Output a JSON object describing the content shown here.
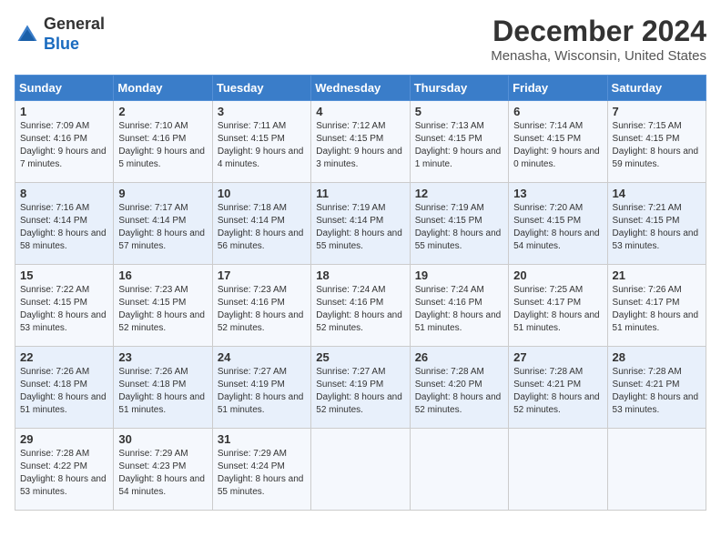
{
  "logo": {
    "general": "General",
    "blue": "Blue"
  },
  "title": "December 2024",
  "location": "Menasha, Wisconsin, United States",
  "days_of_week": [
    "Sunday",
    "Monday",
    "Tuesday",
    "Wednesday",
    "Thursday",
    "Friday",
    "Saturday"
  ],
  "weeks": [
    [
      {
        "day": "1",
        "sunrise": "7:09 AM",
        "sunset": "4:16 PM",
        "daylight": "9 hours and 7 minutes."
      },
      {
        "day": "2",
        "sunrise": "7:10 AM",
        "sunset": "4:16 PM",
        "daylight": "9 hours and 5 minutes."
      },
      {
        "day": "3",
        "sunrise": "7:11 AM",
        "sunset": "4:15 PM",
        "daylight": "9 hours and 4 minutes."
      },
      {
        "day": "4",
        "sunrise": "7:12 AM",
        "sunset": "4:15 PM",
        "daylight": "9 hours and 3 minutes."
      },
      {
        "day": "5",
        "sunrise": "7:13 AM",
        "sunset": "4:15 PM",
        "daylight": "9 hours and 1 minute."
      },
      {
        "day": "6",
        "sunrise": "7:14 AM",
        "sunset": "4:15 PM",
        "daylight": "9 hours and 0 minutes."
      },
      {
        "day": "7",
        "sunrise": "7:15 AM",
        "sunset": "4:15 PM",
        "daylight": "8 hours and 59 minutes."
      }
    ],
    [
      {
        "day": "8",
        "sunrise": "7:16 AM",
        "sunset": "4:14 PM",
        "daylight": "8 hours and 58 minutes."
      },
      {
        "day": "9",
        "sunrise": "7:17 AM",
        "sunset": "4:14 PM",
        "daylight": "8 hours and 57 minutes."
      },
      {
        "day": "10",
        "sunrise": "7:18 AM",
        "sunset": "4:14 PM",
        "daylight": "8 hours and 56 minutes."
      },
      {
        "day": "11",
        "sunrise": "7:19 AM",
        "sunset": "4:14 PM",
        "daylight": "8 hours and 55 minutes."
      },
      {
        "day": "12",
        "sunrise": "7:19 AM",
        "sunset": "4:15 PM",
        "daylight": "8 hours and 55 minutes."
      },
      {
        "day": "13",
        "sunrise": "7:20 AM",
        "sunset": "4:15 PM",
        "daylight": "8 hours and 54 minutes."
      },
      {
        "day": "14",
        "sunrise": "7:21 AM",
        "sunset": "4:15 PM",
        "daylight": "8 hours and 53 minutes."
      }
    ],
    [
      {
        "day": "15",
        "sunrise": "7:22 AM",
        "sunset": "4:15 PM",
        "daylight": "8 hours and 53 minutes."
      },
      {
        "day": "16",
        "sunrise": "7:23 AM",
        "sunset": "4:15 PM",
        "daylight": "8 hours and 52 minutes."
      },
      {
        "day": "17",
        "sunrise": "7:23 AM",
        "sunset": "4:16 PM",
        "daylight": "8 hours and 52 minutes."
      },
      {
        "day": "18",
        "sunrise": "7:24 AM",
        "sunset": "4:16 PM",
        "daylight": "8 hours and 52 minutes."
      },
      {
        "day": "19",
        "sunrise": "7:24 AM",
        "sunset": "4:16 PM",
        "daylight": "8 hours and 51 minutes."
      },
      {
        "day": "20",
        "sunrise": "7:25 AM",
        "sunset": "4:17 PM",
        "daylight": "8 hours and 51 minutes."
      },
      {
        "day": "21",
        "sunrise": "7:26 AM",
        "sunset": "4:17 PM",
        "daylight": "8 hours and 51 minutes."
      }
    ],
    [
      {
        "day": "22",
        "sunrise": "7:26 AM",
        "sunset": "4:18 PM",
        "daylight": "8 hours and 51 minutes."
      },
      {
        "day": "23",
        "sunrise": "7:26 AM",
        "sunset": "4:18 PM",
        "daylight": "8 hours and 51 minutes."
      },
      {
        "day": "24",
        "sunrise": "7:27 AM",
        "sunset": "4:19 PM",
        "daylight": "8 hours and 51 minutes."
      },
      {
        "day": "25",
        "sunrise": "7:27 AM",
        "sunset": "4:19 PM",
        "daylight": "8 hours and 52 minutes."
      },
      {
        "day": "26",
        "sunrise": "7:28 AM",
        "sunset": "4:20 PM",
        "daylight": "8 hours and 52 minutes."
      },
      {
        "day": "27",
        "sunrise": "7:28 AM",
        "sunset": "4:21 PM",
        "daylight": "8 hours and 52 minutes."
      },
      {
        "day": "28",
        "sunrise": "7:28 AM",
        "sunset": "4:21 PM",
        "daylight": "8 hours and 53 minutes."
      }
    ],
    [
      {
        "day": "29",
        "sunrise": "7:28 AM",
        "sunset": "4:22 PM",
        "daylight": "8 hours and 53 minutes."
      },
      {
        "day": "30",
        "sunrise": "7:29 AM",
        "sunset": "4:23 PM",
        "daylight": "8 hours and 54 minutes."
      },
      {
        "day": "31",
        "sunrise": "7:29 AM",
        "sunset": "4:24 PM",
        "daylight": "8 hours and 55 minutes."
      },
      null,
      null,
      null,
      null
    ]
  ],
  "labels": {
    "sunrise": "Sunrise:",
    "sunset": "Sunset:",
    "daylight": "Daylight:"
  }
}
